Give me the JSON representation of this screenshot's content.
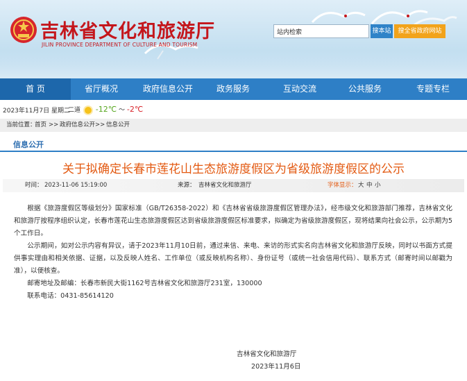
{
  "header": {
    "site_title": "吉林省文化和旅游厅",
    "site_subtitle": "JILIN PROVINCE DEPARTMENT OF CULTURE AND TOURISM",
    "search": {
      "value": "站内检索",
      "button": "搜本站"
    },
    "web_button": "搜全省政府网站"
  },
  "nav": [
    "首 页",
    "省厅概况",
    "政府信息公开",
    "政务服务",
    "互动交流",
    "公共服务",
    "专题专栏"
  ],
  "datebar": {
    "date": "2023年11月7日 星期二",
    "weather_label": "二道",
    "temp_high": "-12℃",
    "temp_sep": "～",
    "temp_low": "-2℃",
    "weather_icon": "sun-icon"
  },
  "breadcrumb": {
    "label": "当前位置：",
    "items": [
      "首页",
      "政府信息公开",
      "信息公开"
    ],
    "sep": ">>"
  },
  "section": "信息公开",
  "article": {
    "title": "关于拟确定长春市莲花山生态旅游度假区为省级旅游度假区的公示",
    "time_label": "时间：",
    "time": "2023-11-06 15:19:00",
    "source_label": "来源：",
    "source": "吉林省文化和旅游厅",
    "fontsize_label": "字体显示：",
    "fontsize_options": [
      "大",
      "中",
      "小"
    ],
    "paragraphs": [
      "根据《旅游度假区等级划分》国家标准（GB/T26358-2022）和《吉林省省级旅游度假区管理办法》，经市级文化和旅游部门推荐，吉林省文化和旅游厅按程序组织认定，长春市莲花山生态旅游度假区达到省级旅游度假区标准要求，拟确定为省级旅游度假区，现将结果向社会公示，公示期为5个工作日。",
      "公示期间，如对公示内容有异议，请于2023年11月10日前，通过来信、来电、来访的形式实名向吉林省文化和旅游厅反映，同时以书面方式提供事实理由和相关依据、证据，以及反映人姓名、工作单位（或反映机构名称）、身份证号（或统一社会信用代码）、联系方式（邮寄时间以邮戳为准），以便核查。",
      "邮寄地址及邮编：长春市新民大街1162号吉林省文化和旅游厅231室，130000",
      "联系电话：0431-85614120"
    ],
    "signature": "吉林省文化和旅游厅",
    "sign_date": "2023年11月6日"
  },
  "colors": {
    "nav_bg": "#2e7fc6",
    "title": "#e35a12",
    "brand_red": "#c4161c",
    "web_button": "#f2a31b"
  }
}
